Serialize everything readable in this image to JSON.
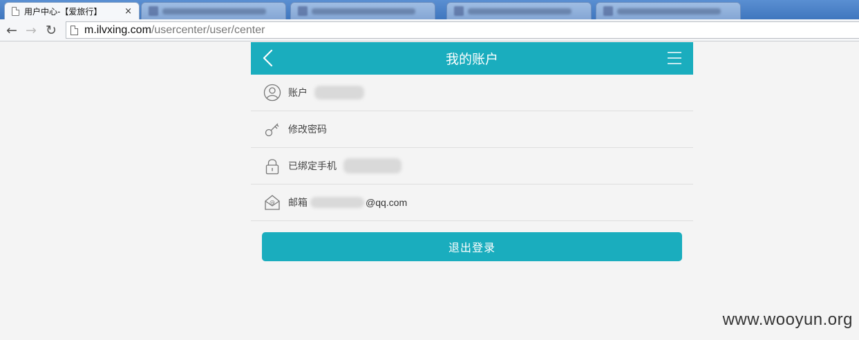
{
  "browser": {
    "tabs": [
      {
        "title": "用户中心-【爱旅行】",
        "active": true,
        "favicon": "page-icon"
      },
      {
        "title": "",
        "active": false
      },
      {
        "title": "",
        "active": false
      },
      {
        "title": "",
        "active": false
      },
      {
        "title": "",
        "active": false
      }
    ],
    "tab_close_glyph": "×",
    "nav": {
      "back_glyph": "←",
      "forward_glyph": "→",
      "reload_glyph": "↻"
    },
    "url_host": "m.ilvxing.com",
    "url_path": "/usercenter/user/center"
  },
  "app": {
    "header": {
      "title": "我的账户",
      "back_icon": "chevron-left-icon",
      "menu_icon": "hamburger-menu-icon"
    },
    "rows": [
      {
        "icon": "user-icon",
        "label": "账户",
        "value": ""
      },
      {
        "icon": "key-icon",
        "label": "修改密码",
        "value": ""
      },
      {
        "icon": "lock-icon",
        "label": "已绑定手机",
        "value": ""
      },
      {
        "icon": "mail-icon",
        "label": "邮箱",
        "value": "@qq.com"
      }
    ],
    "logout_label": "退出登录"
  },
  "watermark": "www.wooyun.org",
  "colors": {
    "accent": "#1aadbe",
    "background": "#f4f4f4",
    "tabstrip": "#4a80c6"
  }
}
